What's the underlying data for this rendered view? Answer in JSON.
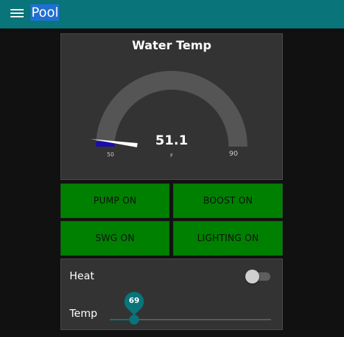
{
  "header": {
    "title": "Pool",
    "menu_icon": "hamburger-menu-icon",
    "bar_color": "#097479"
  },
  "gauge": {
    "title": "Water Temp",
    "value": "51.1",
    "unit": "F",
    "min_label": "50",
    "max_label": "90",
    "min": 50,
    "max": 90,
    "reading": 51.1,
    "arc_color": "#555555",
    "fill_color": "#1a0dab"
  },
  "buttons": {
    "pump": "PUMP ON",
    "boost": "BOOST ON",
    "swg": "SWG ON",
    "lighting": "LIGHTING ON",
    "color": "#008000"
  },
  "controls": {
    "heat_label": "Heat",
    "heat_on": false,
    "temp_label": "Temp",
    "temp_value": "69",
    "temp_fraction": 0.15
  }
}
